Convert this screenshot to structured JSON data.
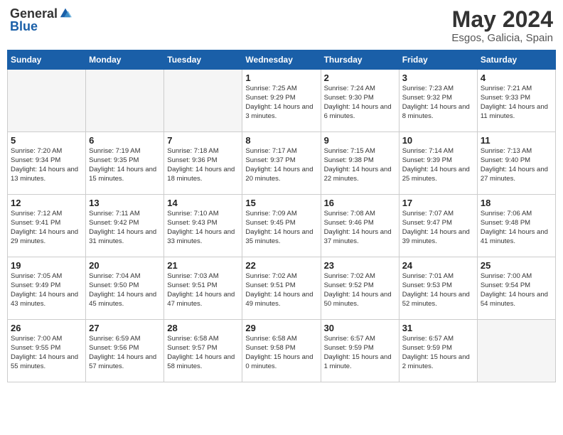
{
  "header": {
    "logo_general": "General",
    "logo_blue": "Blue",
    "month_title": "May 2024",
    "location": "Esgos, Galicia, Spain"
  },
  "weekdays": [
    "Sunday",
    "Monday",
    "Tuesday",
    "Wednesday",
    "Thursday",
    "Friday",
    "Saturday"
  ],
  "weeks": [
    [
      {
        "day": "",
        "sunrise": "",
        "sunset": "",
        "daylight": ""
      },
      {
        "day": "",
        "sunrise": "",
        "sunset": "",
        "daylight": ""
      },
      {
        "day": "",
        "sunrise": "",
        "sunset": "",
        "daylight": ""
      },
      {
        "day": "1",
        "sunrise": "Sunrise: 7:25 AM",
        "sunset": "Sunset: 9:29 PM",
        "daylight": "Daylight: 14 hours and 3 minutes."
      },
      {
        "day": "2",
        "sunrise": "Sunrise: 7:24 AM",
        "sunset": "Sunset: 9:30 PM",
        "daylight": "Daylight: 14 hours and 6 minutes."
      },
      {
        "day": "3",
        "sunrise": "Sunrise: 7:23 AM",
        "sunset": "Sunset: 9:32 PM",
        "daylight": "Daylight: 14 hours and 8 minutes."
      },
      {
        "day": "4",
        "sunrise": "Sunrise: 7:21 AM",
        "sunset": "Sunset: 9:33 PM",
        "daylight": "Daylight: 14 hours and 11 minutes."
      }
    ],
    [
      {
        "day": "5",
        "sunrise": "Sunrise: 7:20 AM",
        "sunset": "Sunset: 9:34 PM",
        "daylight": "Daylight: 14 hours and 13 minutes."
      },
      {
        "day": "6",
        "sunrise": "Sunrise: 7:19 AM",
        "sunset": "Sunset: 9:35 PM",
        "daylight": "Daylight: 14 hours and 15 minutes."
      },
      {
        "day": "7",
        "sunrise": "Sunrise: 7:18 AM",
        "sunset": "Sunset: 9:36 PM",
        "daylight": "Daylight: 14 hours and 18 minutes."
      },
      {
        "day": "8",
        "sunrise": "Sunrise: 7:17 AM",
        "sunset": "Sunset: 9:37 PM",
        "daylight": "Daylight: 14 hours and 20 minutes."
      },
      {
        "day": "9",
        "sunrise": "Sunrise: 7:15 AM",
        "sunset": "Sunset: 9:38 PM",
        "daylight": "Daylight: 14 hours and 22 minutes."
      },
      {
        "day": "10",
        "sunrise": "Sunrise: 7:14 AM",
        "sunset": "Sunset: 9:39 PM",
        "daylight": "Daylight: 14 hours and 25 minutes."
      },
      {
        "day": "11",
        "sunrise": "Sunrise: 7:13 AM",
        "sunset": "Sunset: 9:40 PM",
        "daylight": "Daylight: 14 hours and 27 minutes."
      }
    ],
    [
      {
        "day": "12",
        "sunrise": "Sunrise: 7:12 AM",
        "sunset": "Sunset: 9:41 PM",
        "daylight": "Daylight: 14 hours and 29 minutes."
      },
      {
        "day": "13",
        "sunrise": "Sunrise: 7:11 AM",
        "sunset": "Sunset: 9:42 PM",
        "daylight": "Daylight: 14 hours and 31 minutes."
      },
      {
        "day": "14",
        "sunrise": "Sunrise: 7:10 AM",
        "sunset": "Sunset: 9:43 PM",
        "daylight": "Daylight: 14 hours and 33 minutes."
      },
      {
        "day": "15",
        "sunrise": "Sunrise: 7:09 AM",
        "sunset": "Sunset: 9:45 PM",
        "daylight": "Daylight: 14 hours and 35 minutes."
      },
      {
        "day": "16",
        "sunrise": "Sunrise: 7:08 AM",
        "sunset": "Sunset: 9:46 PM",
        "daylight": "Daylight: 14 hours and 37 minutes."
      },
      {
        "day": "17",
        "sunrise": "Sunrise: 7:07 AM",
        "sunset": "Sunset: 9:47 PM",
        "daylight": "Daylight: 14 hours and 39 minutes."
      },
      {
        "day": "18",
        "sunrise": "Sunrise: 7:06 AM",
        "sunset": "Sunset: 9:48 PM",
        "daylight": "Daylight: 14 hours and 41 minutes."
      }
    ],
    [
      {
        "day": "19",
        "sunrise": "Sunrise: 7:05 AM",
        "sunset": "Sunset: 9:49 PM",
        "daylight": "Daylight: 14 hours and 43 minutes."
      },
      {
        "day": "20",
        "sunrise": "Sunrise: 7:04 AM",
        "sunset": "Sunset: 9:50 PM",
        "daylight": "Daylight: 14 hours and 45 minutes."
      },
      {
        "day": "21",
        "sunrise": "Sunrise: 7:03 AM",
        "sunset": "Sunset: 9:51 PM",
        "daylight": "Daylight: 14 hours and 47 minutes."
      },
      {
        "day": "22",
        "sunrise": "Sunrise: 7:02 AM",
        "sunset": "Sunset: 9:51 PM",
        "daylight": "Daylight: 14 hours and 49 minutes."
      },
      {
        "day": "23",
        "sunrise": "Sunrise: 7:02 AM",
        "sunset": "Sunset: 9:52 PM",
        "daylight": "Daylight: 14 hours and 50 minutes."
      },
      {
        "day": "24",
        "sunrise": "Sunrise: 7:01 AM",
        "sunset": "Sunset: 9:53 PM",
        "daylight": "Daylight: 14 hours and 52 minutes."
      },
      {
        "day": "25",
        "sunrise": "Sunrise: 7:00 AM",
        "sunset": "Sunset: 9:54 PM",
        "daylight": "Daylight: 14 hours and 54 minutes."
      }
    ],
    [
      {
        "day": "26",
        "sunrise": "Sunrise: 7:00 AM",
        "sunset": "Sunset: 9:55 PM",
        "daylight": "Daylight: 14 hours and 55 minutes."
      },
      {
        "day": "27",
        "sunrise": "Sunrise: 6:59 AM",
        "sunset": "Sunset: 9:56 PM",
        "daylight": "Daylight: 14 hours and 57 minutes."
      },
      {
        "day": "28",
        "sunrise": "Sunrise: 6:58 AM",
        "sunset": "Sunset: 9:57 PM",
        "daylight": "Daylight: 14 hours and 58 minutes."
      },
      {
        "day": "29",
        "sunrise": "Sunrise: 6:58 AM",
        "sunset": "Sunset: 9:58 PM",
        "daylight": "Daylight: 15 hours and 0 minutes."
      },
      {
        "day": "30",
        "sunrise": "Sunrise: 6:57 AM",
        "sunset": "Sunset: 9:59 PM",
        "daylight": "Daylight: 15 hours and 1 minute."
      },
      {
        "day": "31",
        "sunrise": "Sunrise: 6:57 AM",
        "sunset": "Sunset: 9:59 PM",
        "daylight": "Daylight: 15 hours and 2 minutes."
      },
      {
        "day": "",
        "sunrise": "",
        "sunset": "",
        "daylight": ""
      }
    ]
  ]
}
